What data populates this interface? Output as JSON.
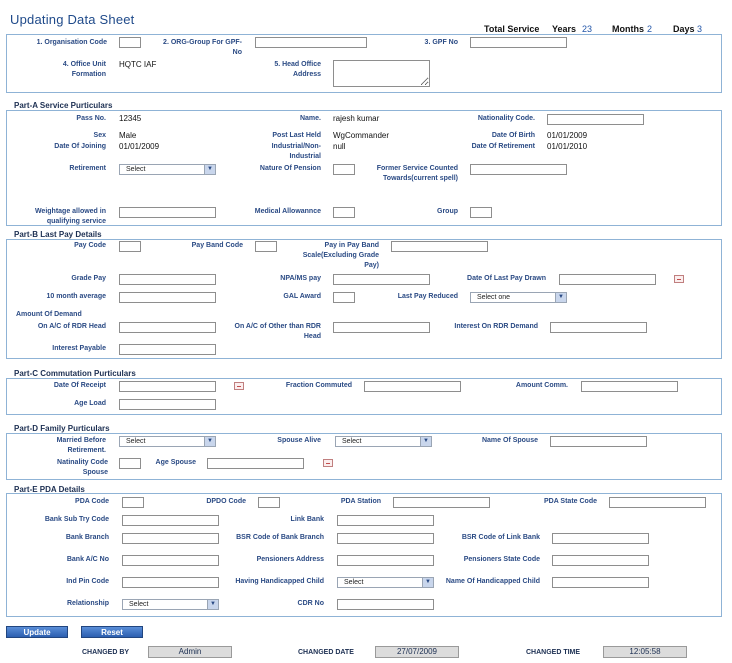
{
  "title": "Updating Data Sheet",
  "service": {
    "total_label": "Total Service",
    "years_label": "Years",
    "years_value": "23",
    "months_label": "Months",
    "months_value": "2",
    "days_label": "Days",
    "days_value": "3"
  },
  "top": {
    "org_code_label": "1. Organisation Code",
    "org_group_label": "2. ORG-Group For GPF-No",
    "gpf_no_label": "3. GPF No",
    "office_unit_label": "4. Office Unit Formation",
    "office_unit_value": "HQTC IAF",
    "head_office_label": "5. Head Office Address"
  },
  "part_a": {
    "heading": "Part-A Service Purticulars",
    "pass_no_label": "Pass No.",
    "pass_no_value": "12345",
    "name_label": "Name.",
    "name_value": "rajesh kumar",
    "nationality_label": "Nationality Code.",
    "sex_label": "Sex",
    "sex_value": "Male",
    "post_label": "Post Last Held",
    "post_value": "WgCommander",
    "dob_label": "Date Of Birth",
    "dob_value": "01/01/2009",
    "doj_label": "Date Of Joining",
    "doj_value": "01/01/2009",
    "industrial_label": "Industrial/Non-Industrial",
    "industrial_value": "null",
    "dor_label": "Date Of Retirement",
    "dor_value": "01/01/2010",
    "retirement_label": "Retirement",
    "retirement_select": "Select",
    "nature_pension_label": "Nature Of Pension",
    "former_service_label": "Former Service Counted Towards(current spell)",
    "weightage_label": "Weightage allowed in qualifying service",
    "medical_label": "Medical Allowannce",
    "group_label": "Group"
  },
  "part_b": {
    "heading": "Part-B Last Pay Details",
    "pay_code_label": "Pay Code",
    "pay_band_code_label": "Pay Band Code",
    "pay_band_scale_label": "Pay in Pay Band Scale(Excluding Grade Pay)",
    "grade_pay_label": "Grade Pay",
    "npa_label": "NPA/MS pay",
    "date_last_pay_label": "Date Of Last Pay Drawn",
    "ten_month_label": "10 month average",
    "gal_label": "GAL Award",
    "last_pay_reduced_label": "Last Pay Reduced",
    "last_pay_reduced_select": "Select one",
    "amount_demand_label": "Amount Of Demand",
    "rdr_head_label": "On A/C of RDR Head",
    "other_rdr_label": "On A/C of Other than RDR Head",
    "interest_rdr_label": "Interest On RDR Demand",
    "interest_payable_label": "Interest Payable"
  },
  "part_c": {
    "heading": "Part-C Commutation Purticulars",
    "date_receipt_label": "Date Of Receipt",
    "fraction_label": "Fraction Commuted",
    "amount_comm_label": "Amount Comm.",
    "age_load_label": "Age Load"
  },
  "part_d": {
    "heading": "Part-D Family Purticulars",
    "married_label": "Married Before Retirement.",
    "married_select": "Select",
    "spouse_alive_label": "Spouse Alive",
    "spouse_alive_select": "Select",
    "name_spouse_label": "Name Of Spouse",
    "nationality_spouse_label": "Natinality Code Spouse",
    "age_spouse_label": "Age Spouse"
  },
  "part_e": {
    "heading": "Part-E PDA Details",
    "pda_code_label": "PDA Code",
    "dpdo_code_label": "DPDO Code",
    "pda_station_label": "PDA Station",
    "pda_state_label": "PDA State Code",
    "bank_sub_try_label": "Bank Sub Try Code",
    "link_bank_label": "Link Bank",
    "bank_branch_label": "Bank Branch",
    "bsr_branch_label": "BSR Code of Bank Branch",
    "bsr_link_label": "BSR Code of Link Bank",
    "bank_ac_label": "Bank A/C No",
    "pensioner_addr_label": "Pensioners Address",
    "pensioner_state_label": "Pensioners State Code",
    "ind_pin_label": "Ind Pin Code",
    "handicapped_child_label": "Having Handicapped Child",
    "handicapped_child_select": "Select",
    "name_handicapped_label": "Name Of Handicapped Child",
    "relationship_label": "Relationship",
    "relationship_select": "Select",
    "cdr_label": "CDR No"
  },
  "actions": {
    "update_label": "Update",
    "reset_label": "Reset"
  },
  "footer": {
    "changed_by_label": "CHANGED BY",
    "changed_by_value": "Admin",
    "changed_date_label": "CHANGED DATE",
    "changed_date_value": "27/07/2009",
    "changed_time_label": "CHANGED TIME",
    "changed_time_value": "12:05:58"
  },
  "colors": {
    "title": "#1f4a8a",
    "label": "#2a4a84",
    "panel_border": "#8fb3d6",
    "button": "#2c5fb0"
  }
}
